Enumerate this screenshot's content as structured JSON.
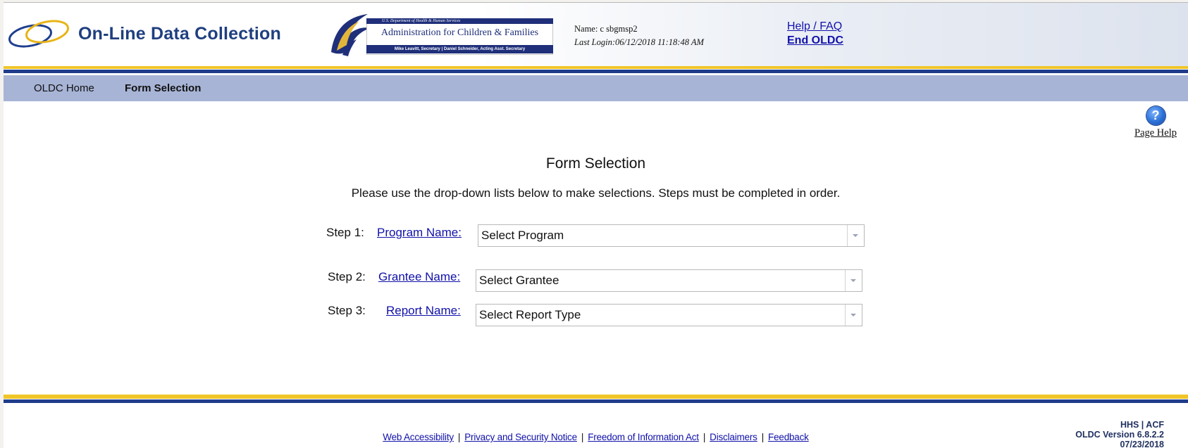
{
  "header": {
    "app_title": "On-Line Data Collection",
    "acf": {
      "department": "U.S. Department of Health & Human Services",
      "name": "Administration for Children & Families",
      "officials": "Mike Leavitt, Secretary  |  Daniel Schneider, Acting Asst. Secretary"
    },
    "user_name": "Name: c sbgmsp2",
    "last_login": "Last Login:06/12/2018 11:18:48 AM",
    "help_link": "Help / FAQ",
    "end_link": "End OLDC"
  },
  "nav": {
    "items": [
      {
        "label": "OLDC Home",
        "active": false
      },
      {
        "label": "Form Selection",
        "active": true
      }
    ]
  },
  "page_help": {
    "label": "Page Help",
    "icon": "question-icon"
  },
  "form": {
    "title": "Form Selection",
    "instructions": "Please use the drop-down lists below to make selections. Steps must be completed in order.",
    "steps": [
      {
        "step": "Step 1:",
        "label": "Program Name:",
        "value": "Select Program"
      },
      {
        "step": "Step 2:",
        "label": "Grantee Name:",
        "value": "Select Grantee"
      },
      {
        "step": "Step 3:",
        "label": "Report Name:",
        "value": "Select Report Type"
      }
    ]
  },
  "footer": {
    "links": [
      "Web Accessibility",
      "Privacy and Security Notice",
      "Freedom of Information Act",
      "Disclaimers",
      "Feedback"
    ],
    "org": "HHS | ACF",
    "version": "OLDC Version 6.8.2.2",
    "date": "07/23/2018"
  },
  "colors": {
    "nav_background": "#a7b4d6",
    "stripe_gold": "#f0c528",
    "stripe_navy": "#1f3c8a",
    "link": "#1111aa",
    "title_blue": "#1f3f7f"
  }
}
